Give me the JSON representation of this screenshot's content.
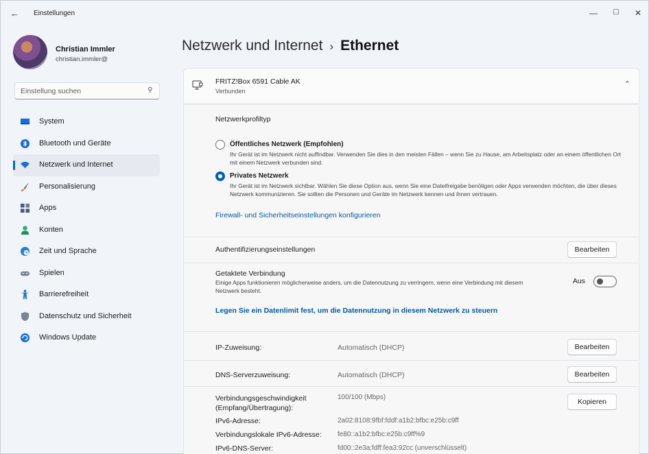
{
  "window": {
    "title": "Einstellungen",
    "back_icon": "back-arrow-icon",
    "minimize": "—",
    "maximize": "☐",
    "close": "✕"
  },
  "profile": {
    "name": "Christian Immler",
    "email": "christian.immler@"
  },
  "search": {
    "placeholder": "Einstellung suchen"
  },
  "sidebar": {
    "items": [
      {
        "label": "System",
        "icon": "system-icon",
        "color": "#1a6fd4"
      },
      {
        "label": "Bluetooth und Geräte",
        "icon": "bluetooth-icon",
        "color": "#1a6fd4"
      },
      {
        "label": "Netzwerk und Internet",
        "icon": "wifi-icon",
        "color": "#1a6fd4",
        "active": true
      },
      {
        "label": "Personalisierung",
        "icon": "brush-icon",
        "color": "#d88a2f"
      },
      {
        "label": "Apps",
        "icon": "apps-icon",
        "color": "#4b5a7a"
      },
      {
        "label": "Konten",
        "icon": "person-icon",
        "color": "#2bb07a"
      },
      {
        "label": "Zeit und Sprache",
        "icon": "globe-clock-icon",
        "color": "#2a7fc9"
      },
      {
        "label": "Spielen",
        "icon": "gamepad-icon",
        "color": "#7a8594"
      },
      {
        "label": "Barrierefreiheit",
        "icon": "accessibility-icon",
        "color": "#1a6fd4"
      },
      {
        "label": "Datenschutz und Sicherheit",
        "icon": "shield-icon",
        "color": "#7a8594"
      },
      {
        "label": "Windows Update",
        "icon": "update-icon",
        "color": "#1a6fd4"
      }
    ]
  },
  "header": {
    "parent": "Netzwerk und Internet",
    "separator": "›",
    "current": "Ethernet"
  },
  "device": {
    "name": "FRITZ!Box 6591 Cable AK",
    "status": "Verbunden"
  },
  "network_profile": {
    "label": "Netzwerkprofiltyp",
    "options": [
      {
        "title": "Öffentliches Netzwerk (Empfohlen)",
        "desc": "Ihr Gerät ist im Netzwerk nicht auffindbar. Verwenden Sie dies in den meisten Fällen – wenn Sie zu Hause, am Arbeitsplatz oder an einem öffentlichen Ort mit einem Netzwerk verbunden sind.",
        "selected": false
      },
      {
        "title": "Privates Netzwerk",
        "desc": "Ihr Gerät ist im Netzwerk sichtbar. Wählen Sie diese Option aus, wenn Sie eine Dateifreigabe benötigen oder Apps verwenden möchten, die über dieses Netzwerk kommunizieren. Sie sollten die Personen und Geräte im Netzwerk kennen und ihnen vertrauen.",
        "selected": true
      }
    ],
    "firewall_link": "Firewall- und Sicherheitseinstellungen konfigurieren"
  },
  "auth": {
    "label": "Authentifizierungseinstellungen",
    "button": "Bearbeiten"
  },
  "metered": {
    "label": "Getaktete Verbindung",
    "desc": "Einige Apps funktionieren möglicherweise anders, um die Datennutzung zu verringern, wenn eine Verbindung mit diesem Netzwerk besteht.",
    "toggle_label": "Aus",
    "toggle_on": false,
    "data_limit_link": "Legen Sie ein Datenlimit fest, um die Datennutzung in diesem Netzwerk zu steuern"
  },
  "ip": {
    "label": "IP-Zuweisung:",
    "value": "Automatisch (DHCP)",
    "button": "Bearbeiten"
  },
  "dns": {
    "label": "DNS-Serverzuweisung:",
    "value": "Automatisch (DHCP)",
    "button": "Bearbeiten"
  },
  "properties": {
    "copy_button": "Kopieren",
    "items": [
      {
        "label": "Verbindungsgeschwindigkeit (Empfang/Übertragung):",
        "value": "100/100 (Mbps)"
      },
      {
        "label": "IPv6-Adresse:",
        "value": "2a02:8108:9fbf:fddf:a1b2:bfbc:e25b:c9ff"
      },
      {
        "label": "Verbindungslokale IPv6-Adresse:",
        "value": "fe80::a1b2:bfbc:e25b:c9ff%9"
      },
      {
        "label": "IPv6-DNS-Server:",
        "value": "fd00::2e3a:fdff:fea3:92cc (unverschlüsselt)"
      }
    ]
  },
  "colors": {
    "accent": "#005fb8",
    "link": "#0058a8",
    "background": "#f1f4f9"
  }
}
